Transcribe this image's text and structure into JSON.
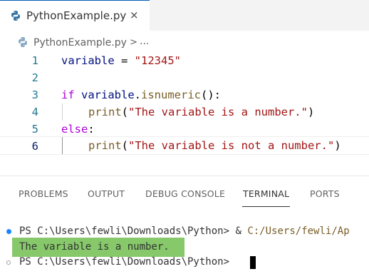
{
  "tabs": [
    {
      "label": "PythonExample.py",
      "icon": "python-file-icon",
      "close_glyph": "×"
    }
  ],
  "breadcrumb": {
    "file": "PythonExample.py",
    "separator": ">",
    "more": "..."
  },
  "editor": {
    "lines": [
      {
        "number": "1"
      },
      {
        "number": "2"
      },
      {
        "number": "3"
      },
      {
        "number": "4"
      },
      {
        "number": "5"
      },
      {
        "number": "6"
      }
    ],
    "code": {
      "l1_var": "variable",
      "l1_eq": " = ",
      "l1_str": "\"12345\"",
      "l3_if": "if",
      "l3_sp": " ",
      "l3_var": "variable",
      "l3_dot": ".",
      "l3_fn": "isnumeric",
      "l3_rest": "():",
      "l4_fn": "print",
      "l4_open": "(",
      "l4_str": "\"The variable is a number.\"",
      "l4_close": ")",
      "l5_else": "else",
      "l5_colon": ":",
      "l6_fn": "print",
      "l6_open": "(",
      "l6_str": "\"The variable is not a number.\"",
      "l6_close": ")"
    },
    "active_line": 6
  },
  "panel": {
    "tabs": [
      "PROBLEMS",
      "OUTPUT",
      "DEBUG CONSOLE",
      "TERMINAL",
      "PORTS"
    ],
    "active_tab": "TERMINAL"
  },
  "terminal": {
    "prompt1": "PS C:\\Users\\fewli\\Downloads\\Python>",
    "command_amp": "&",
    "command_path": "C:/Users/fewli/Ap",
    "output": "The variable is a number.",
    "prompt2": "PS C:\\Users\\fewli\\Downloads\\Python>"
  },
  "colors": {
    "keyword": "#0000ff",
    "control_keyword": "#af00db",
    "variable": "#001080",
    "function": "#795e26",
    "string": "#a31515",
    "line_number": "#237893",
    "output_highlight": "#87c96a",
    "status_dot": "#1a85ff"
  }
}
